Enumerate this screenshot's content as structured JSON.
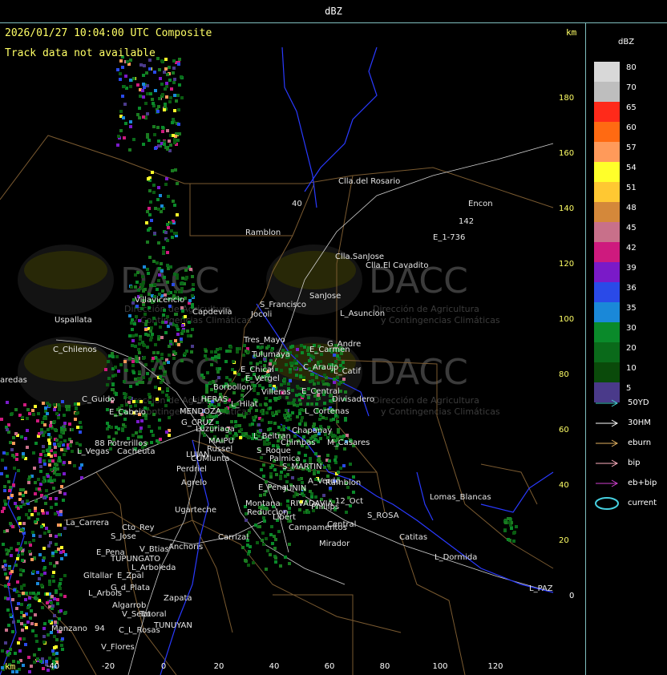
{
  "title": "dBZ",
  "header": {
    "timestamp": "2026/01/27 10:04:00 UTC Composite",
    "notice": "Track data not available",
    "km_top": "km",
    "km_bottom": "km"
  },
  "watermark": {
    "brand": "DACC",
    "line1": "Dirección de Agricultura",
    "line2": "y Contingencias Climáticas"
  },
  "y_ticks": [
    "180",
    "160",
    "140",
    "120",
    "100",
    "80",
    "60",
    "40",
    "20",
    "0"
  ],
  "x_ticks": [
    "-40",
    "-20",
    "0",
    "20",
    "40",
    "60",
    "80",
    "100",
    "120"
  ],
  "places": [
    {
      "name": "Clla.del Rosario"
    },
    {
      "name": "Encon"
    },
    {
      "name": "142"
    },
    {
      "name": "E_1-736"
    },
    {
      "name": "Ramblon"
    },
    {
      "name": "40"
    },
    {
      "name": "Clla.SanJose"
    },
    {
      "name": "Clla.El Cavadito"
    },
    {
      "name": "Villavicencio"
    },
    {
      "name": "S_Francisco"
    },
    {
      "name": "SanJose"
    },
    {
      "name": "Capdevila"
    },
    {
      "name": "Jocoli"
    },
    {
      "name": "L_Asuncion"
    },
    {
      "name": "Uspallata"
    },
    {
      "name": "Tres_Mayo"
    },
    {
      "name": "G_Andre"
    },
    {
      "name": "Tulumaya"
    },
    {
      "name": "E_Carmen"
    },
    {
      "name": "C_Chilenos"
    },
    {
      "name": "C_Araujo"
    },
    {
      "name": "E_Chical"
    },
    {
      "name": "L_Catif"
    },
    {
      "name": "aredas"
    },
    {
      "name": "E_Vergel"
    },
    {
      "name": "Borbollon"
    },
    {
      "name": "Villeras"
    },
    {
      "name": "E_Central"
    },
    {
      "name": "Divisadero"
    },
    {
      "name": "C_Guido"
    },
    {
      "name": "L_HERAS"
    },
    {
      "name": "L_Hilat"
    },
    {
      "name": "L_Cortenas"
    },
    {
      "name": "E_Cabeio"
    },
    {
      "name": "MENDOZA"
    },
    {
      "name": "G_CRUZ"
    },
    {
      "name": "Chapanay"
    },
    {
      "name": "Luzuriaga"
    },
    {
      "name": "L_Beltran"
    },
    {
      "name": "MAIPU"
    },
    {
      "name": "Chimbas"
    },
    {
      "name": "M_Casares"
    },
    {
      "name": "Potrerillos"
    },
    {
      "name": "Russel"
    },
    {
      "name": "88"
    },
    {
      "name": "L_Vegas"
    },
    {
      "name": "Cacheuta"
    },
    {
      "name": "LUJAN"
    },
    {
      "name": "S_Roque"
    },
    {
      "name": "CUMlunta"
    },
    {
      "name": "Palmica"
    },
    {
      "name": "Perdriel"
    },
    {
      "name": "S_MARTIN"
    },
    {
      "name": "A_Verde"
    },
    {
      "name": "Agrelo"
    },
    {
      "name": "Ramblon"
    },
    {
      "name": "E_Pena"
    },
    {
      "name": "JUNIN"
    },
    {
      "name": "Lomas_Blancas"
    },
    {
      "name": "12_Oct"
    },
    {
      "name": "Montana"
    },
    {
      "name": "RIVADAVIA"
    },
    {
      "name": "Phillips"
    },
    {
      "name": "Ugarteche"
    },
    {
      "name": "Reduccion"
    },
    {
      "name": "S_ROSA"
    },
    {
      "name": "La_Carrera"
    },
    {
      "name": "Cto_Rey"
    },
    {
      "name": "Libert"
    },
    {
      "name": "Central"
    },
    {
      "name": "S_Jose"
    },
    {
      "name": "Campamentos"
    },
    {
      "name": "Carrizal"
    },
    {
      "name": "Catitas"
    },
    {
      "name": "V_Btias"
    },
    {
      "name": "Anchoris"
    },
    {
      "name": "Mirador"
    },
    {
      "name": "E_Pena"
    },
    {
      "name": "TUPUNGATO"
    },
    {
      "name": "L_Dormida"
    },
    {
      "name": "L_Arboleda"
    },
    {
      "name": "Gltallar"
    },
    {
      "name": "E_Zpal"
    },
    {
      "name": "G_d_Plata"
    },
    {
      "name": "L_PAZ"
    },
    {
      "name": "L_Arbols"
    },
    {
      "name": "Zapata"
    },
    {
      "name": "Algarrob"
    },
    {
      "name": "V_Seco"
    },
    {
      "name": "Totoral"
    },
    {
      "name": "TUNUYAN"
    },
    {
      "name": "Manzano"
    },
    {
      "name": "94"
    },
    {
      "name": "C_L_Rosas"
    },
    {
      "name": "V_Flores"
    }
  ],
  "legend": {
    "title": "dBZ",
    "levels": [
      {
        "label": "80",
        "color": "#d8d8d8"
      },
      {
        "label": "70",
        "color": "#bebebe"
      },
      {
        "label": "65",
        "color": "#ff2a1a"
      },
      {
        "label": "60",
        "color": "#ff6a12"
      },
      {
        "label": "57",
        "color": "#ff9a5a"
      },
      {
        "label": "54",
        "color": "#ffff2a"
      },
      {
        "label": "51",
        "color": "#ffc832"
      },
      {
        "label": "48",
        "color": "#d4883a"
      },
      {
        "label": "45",
        "color": "#c8708a"
      },
      {
        "label": "42",
        "color": "#ce1a7e"
      },
      {
        "label": "39",
        "color": "#7a1ac8"
      },
      {
        "label": "36",
        "color": "#2a4ae8"
      },
      {
        "label": "35",
        "color": "#1a88d8"
      },
      {
        "label": "30",
        "color": "#0a8a2a"
      },
      {
        "label": "20",
        "color": "#0a6a1a"
      },
      {
        "label": "10",
        "color": "#0a4a0a"
      },
      {
        "label": "5",
        "color": "#4a3a8a"
      }
    ]
  },
  "tracks": [
    {
      "label": "50YD",
      "color": "#46d0d0"
    },
    {
      "label": "30HM",
      "color": "#ffffff"
    },
    {
      "label": "eburn",
      "color": "#e0b060"
    },
    {
      "label": "bip",
      "color": "#ffb0c0"
    },
    {
      "label": "eb+bip",
      "color": "#d040d0"
    },
    {
      "label": "current",
      "color": "#46d0e0"
    }
  ]
}
